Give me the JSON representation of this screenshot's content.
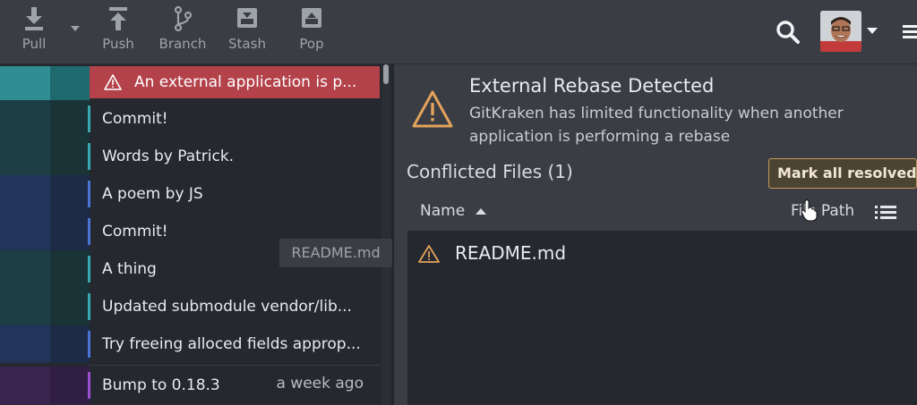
{
  "toolbar": {
    "pull": "Pull",
    "push": "Push",
    "branch": "Branch",
    "stash": "Stash",
    "pop": "Pop"
  },
  "commits": [
    {
      "message": "An external application is p...",
      "time": ""
    },
    {
      "message": "Commit!",
      "time": ""
    },
    {
      "message": "Words by Patrick.",
      "time": ""
    },
    {
      "message": "A poem by JS",
      "time": ""
    },
    {
      "message": "Commit!",
      "time": ""
    },
    {
      "message": "A thing",
      "time": ""
    },
    {
      "message": "Updated submodule vendor/lib...",
      "time": ""
    },
    {
      "message": "Try freeing alloced fields approp...",
      "time": ""
    },
    {
      "message": "Bump to 0.18.3",
      "time": "a week ago"
    }
  ],
  "drag_tooltip": "README.md",
  "rebase_banner": {
    "title": "External Rebase Detected",
    "text": "GitKraken has limited functionality when another application is performing a rebase"
  },
  "conflicts": {
    "title": "Conflicted Files (1)",
    "mark_all": "Mark all resolved",
    "col_name": "Name",
    "col_path": "File Path",
    "files": [
      {
        "name": "README.md"
      }
    ]
  },
  "colors": {
    "alert": "#b3424b",
    "warning": "#e3a35c",
    "accent_button_border": "#c49a58"
  }
}
